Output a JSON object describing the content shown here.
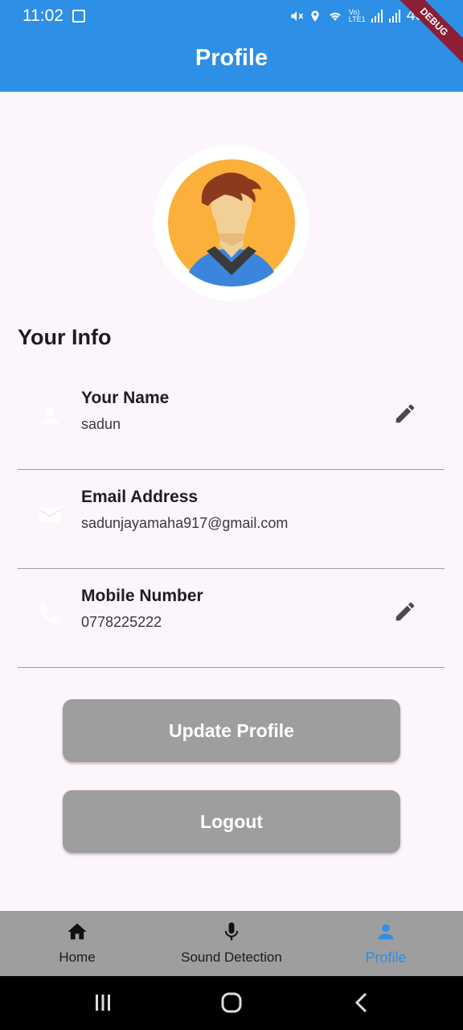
{
  "status": {
    "time": "11:02",
    "battery": "45",
    "network": "Vo) LTE1",
    "debug": "DEBUG"
  },
  "header": {
    "title": "Profile"
  },
  "profile": {
    "section_title": "Your Info",
    "fields": [
      {
        "label": "Your Name",
        "value": "sadun",
        "icon": "person-icon",
        "editable": true
      },
      {
        "label": "Email Address",
        "value": "sadunjayamaha917@gmail.com",
        "icon": "email-icon",
        "editable": false
      },
      {
        "label": "Mobile Number",
        "value": "0778225222",
        "icon": "phone-icon",
        "editable": true
      }
    ]
  },
  "buttons": {
    "update": "Update Profile",
    "logout": "Logout"
  },
  "nav": {
    "items": [
      {
        "label": "Home",
        "icon": "home-icon"
      },
      {
        "label": "Sound Detection",
        "icon": "mic-icon"
      },
      {
        "label": "Profile",
        "icon": "person-icon"
      }
    ],
    "active": "Profile"
  },
  "colors": {
    "primary": "#2d8fe6",
    "button": "#9e9e9e",
    "background": "#fdf5fc",
    "nav_background": "#9e9e9e"
  }
}
